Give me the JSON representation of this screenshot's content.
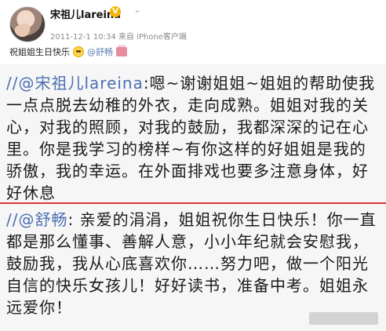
{
  "header": {
    "username": "宋祖儿lareina",
    "timestamp": "2011-12-1 10:34",
    "source": "来自 iPhone客户端",
    "post_text": "祝姐姐生日快乐",
    "post_mention": "@舒畅"
  },
  "badge": {
    "text": "V",
    "color": "#f5b400"
  },
  "block1": {
    "mention": "//@宋祖儿lareina",
    "text": ":嗯~谢谢姐姐~姐姐的帮助使我一点点脱去幼稚的外衣，走向成熟。姐姐对我的关心，对我的照顾，对我的鼓励，我都深深的记在心里。你是我学习的榜样~有你这样的好姐姐是我的骄傲，我的幸运。在外面排戏也要多注意身体，好好休息"
  },
  "block2": {
    "mention": "//@舒畅",
    "text": ": 亲爱的涓涓，姐姐祝你生日快乐！你一直都是那么懂事、善解人意，小小年纪就会安慰我，鼓励我，我从心底喜欢你……努力吧，做一个阳光自信的快乐女孩儿！好好读书，准备中考。姐姐永远爱你！"
  },
  "colors": {
    "mention": "#4a6fb2",
    "divider": "#d63a3a",
    "badge": "#f5b400"
  }
}
